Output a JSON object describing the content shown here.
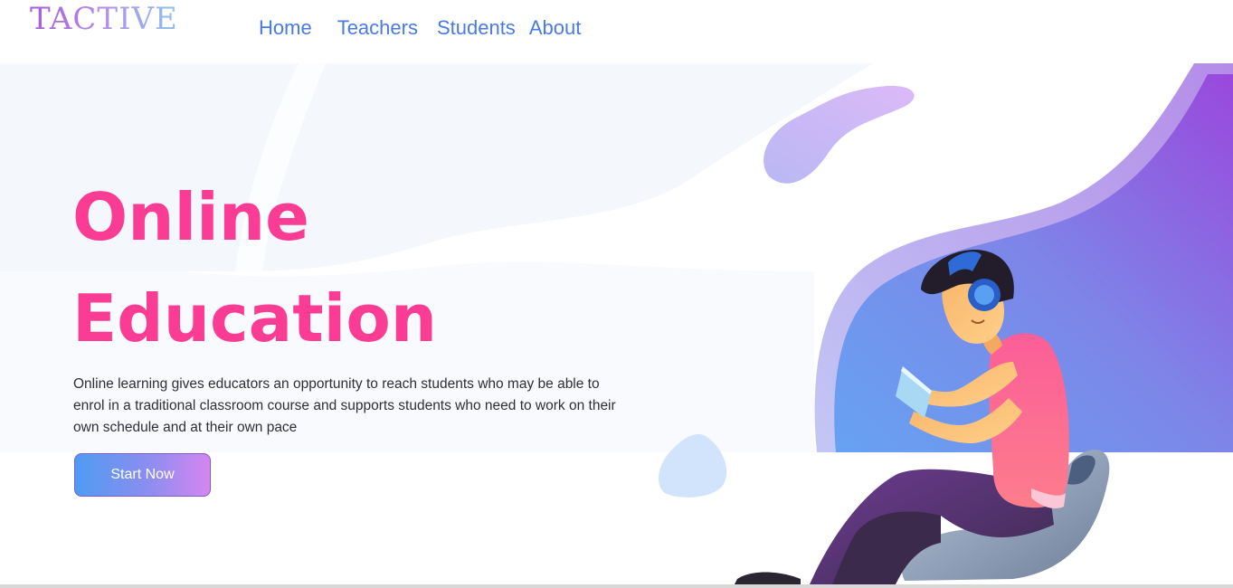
{
  "header": {
    "logo_text": "TACTIVE",
    "nav": [
      {
        "label": "Home"
      },
      {
        "label": "Teachers"
      },
      {
        "label": "Students"
      },
      {
        "label": "About"
      }
    ]
  },
  "hero": {
    "title_line1": "Online",
    "title_line2": "Education",
    "description": "Online learning gives educators an opportunity to reach students who may be able to enrol in a traditional classroom course and supports students who need to work on their own schedule and at their own pace",
    "cta_label": "Start Now"
  },
  "colors": {
    "title": "#fb3c95",
    "nav": "#4a7ae3",
    "accent_purple": "#8a4fe0",
    "accent_blue": "#5f9cf0"
  },
  "illustration": {
    "subject": "student-with-headphones-and-tablet-illustration"
  }
}
